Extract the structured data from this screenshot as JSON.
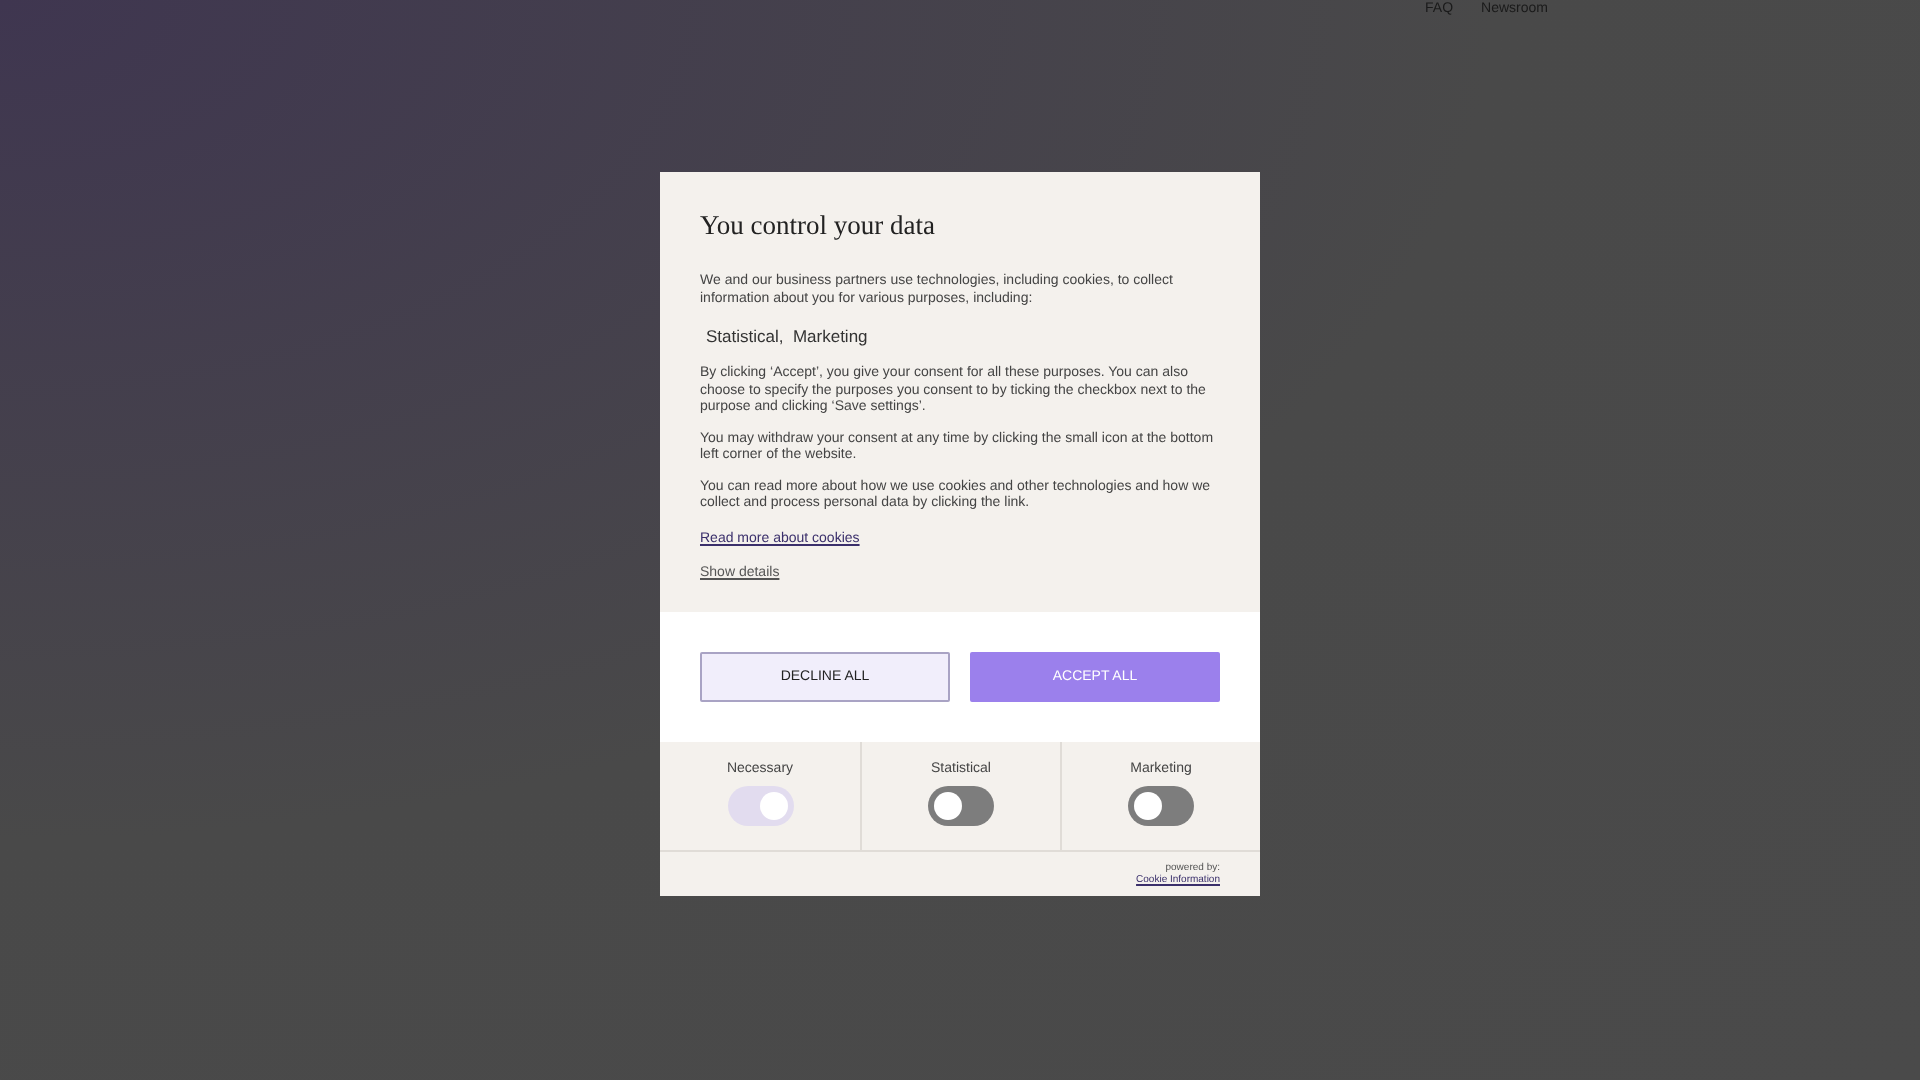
{
  "nav": {
    "links": [
      "FAQ",
      "Newsroom"
    ]
  },
  "dialog": {
    "title": "You control your data",
    "intro": "We and our business partners use technologies, including cookies, to collect information about you for various purposes, including:",
    "purposes": "Statistical,  Marketing",
    "paragraphs": [
      "By clicking ‘Accept’, you give your consent for all these purposes. You can also choose to specify the purposes you consent to by ticking the checkbox next to the purpose and clicking ‘Save settings’.",
      "You may withdraw your consent at any time by clicking the small icon at the bottom left corner of the website.",
      "You can read more about how we use cookies and other technologies and how we collect and process personal data by clicking the link."
    ],
    "read_more_link": "Read more about cookies",
    "show_details_link": "Show details",
    "buttons": [
      {
        "label": "DECLINE ALL",
        "kind": "secondary"
      },
      {
        "label": "ACCEPT ALL",
        "kind": "primary"
      }
    ],
    "toggles": [
      {
        "label": "Necessary",
        "on": true,
        "disabled": true
      },
      {
        "label": "Statistical",
        "on": false,
        "disabled": false
      },
      {
        "label": "Marketing",
        "on": false,
        "disabled": false
      }
    ],
    "powered_by": "powered by:",
    "provider_link": "Cookie Information"
  }
}
